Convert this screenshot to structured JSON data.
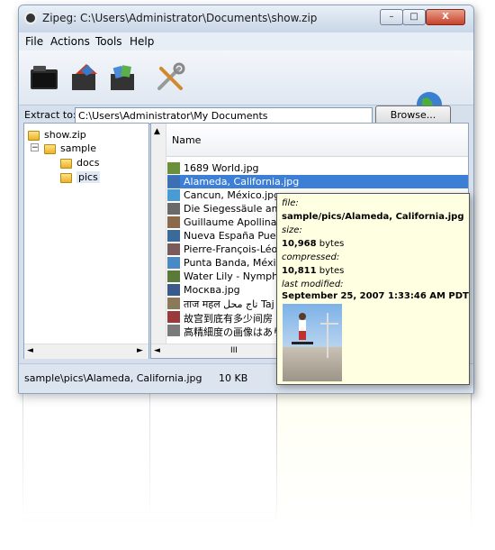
{
  "window": {
    "title": "Zipeg: C:\\Users\\Administrator\\Documents\\show.zip",
    "minimize": "–",
    "maximize": "□",
    "close": "X"
  },
  "menu": [
    "File",
    "Actions",
    "Tools",
    "Help"
  ],
  "toolbar": {
    "icons": [
      "open-archive-icon",
      "extract-icon",
      "extract-all-icon",
      "tools-icon",
      "globe-icon"
    ]
  },
  "extract": {
    "label": "Extract to:",
    "value": "C:\\Users\\Administrator\\My Documents",
    "browse_label": "Browse..."
  },
  "tree": {
    "items": [
      {
        "label": "show.zip",
        "depth": 0
      },
      {
        "label": "sample",
        "depth": 1
      },
      {
        "label": "docs",
        "depth": 2
      },
      {
        "label": "pics",
        "depth": 2,
        "selected": true
      }
    ]
  },
  "filelist": {
    "column": "Name",
    "scroll_thumb": "III",
    "rows": [
      {
        "name": "1689 World.jpg"
      },
      {
        "name": "Alameda, California.jpg",
        "selected": true
      },
      {
        "name": "Cancun, México.jpg"
      },
      {
        "name": "Die Siegessäule am Groß"
      },
      {
        "name": "Guillaume Apollinaire, Ho"
      },
      {
        "name": "Nueva España Puerto de"
      },
      {
        "name": "Pierre-François-Léonard"
      },
      {
        "name": "Punta Banda, México.jpg"
      },
      {
        "name": "Water Lily - Nymphaeace"
      },
      {
        "name": "Москва.jpg"
      },
      {
        "name": "ताज महल تاج محل Taj Mah"
      },
      {
        "name": "故宫到底有多少间房 最"
      },
      {
        "name": "高精細度の画像はありま"
      }
    ]
  },
  "status": {
    "path": "sample\\pics\\Alameda, California.jpg",
    "size": "10 KB"
  },
  "tooltip": {
    "file_label": "file:",
    "file_value": "sample/pics/Alameda, California.jpg",
    "size_label": "size:",
    "size_value": "10,968",
    "size_unit": "bytes",
    "compressed_label": "compressed:",
    "compressed_value": "10,811",
    "compressed_unit": "bytes",
    "modified_label": "last modified:",
    "modified_value": "September 25, 2007 1:33:46 AM PDT"
  },
  "colors": {
    "selection": "#3d7fd6",
    "tooltip_bg": "#ffffe1",
    "window_frame": "#d6e0ec"
  }
}
